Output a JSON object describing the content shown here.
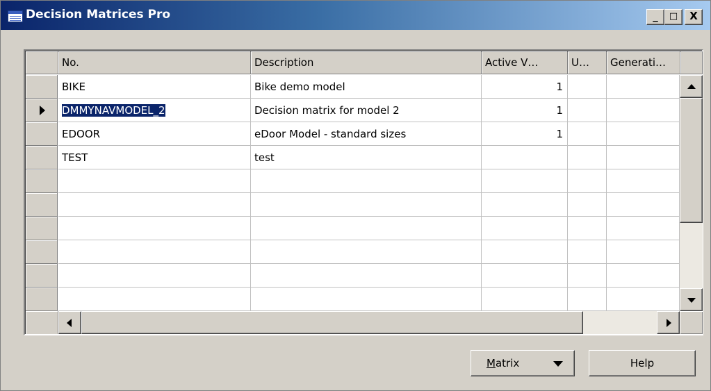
{
  "window": {
    "title": "Decision Matrices Pro",
    "controls": {
      "minimize": "_",
      "maximize": "□",
      "close": "X"
    }
  },
  "grid": {
    "columns": [
      "No.",
      "Description",
      "Active V…",
      "U…",
      "Generati…"
    ],
    "rows": [
      {
        "no": "BIKE",
        "description": "Bike demo model",
        "active_version": "1",
        "u": "",
        "generation": ""
      },
      {
        "no": "DMMYNAVMODEL_2",
        "description": "Decision matrix for model 2",
        "active_version": "1",
        "u": "",
        "generation": ""
      },
      {
        "no": "EDOOR",
        "description": "eDoor Model - standard sizes",
        "active_version": "1",
        "u": "",
        "generation": ""
      },
      {
        "no": "TEST",
        "description": "test",
        "active_version": "",
        "u": "",
        "generation": ""
      }
    ],
    "selected_row_index": 1
  },
  "buttons": {
    "matrix": {
      "label": "Matrix",
      "mnemonic": "M",
      "rest": "atrix"
    },
    "help": {
      "label": "Help"
    }
  },
  "colors": {
    "title_gradient_start": "#0a246a",
    "title_gradient_end": "#a6caf0",
    "selection": "#0a246a",
    "face": "#d4d0c8"
  }
}
